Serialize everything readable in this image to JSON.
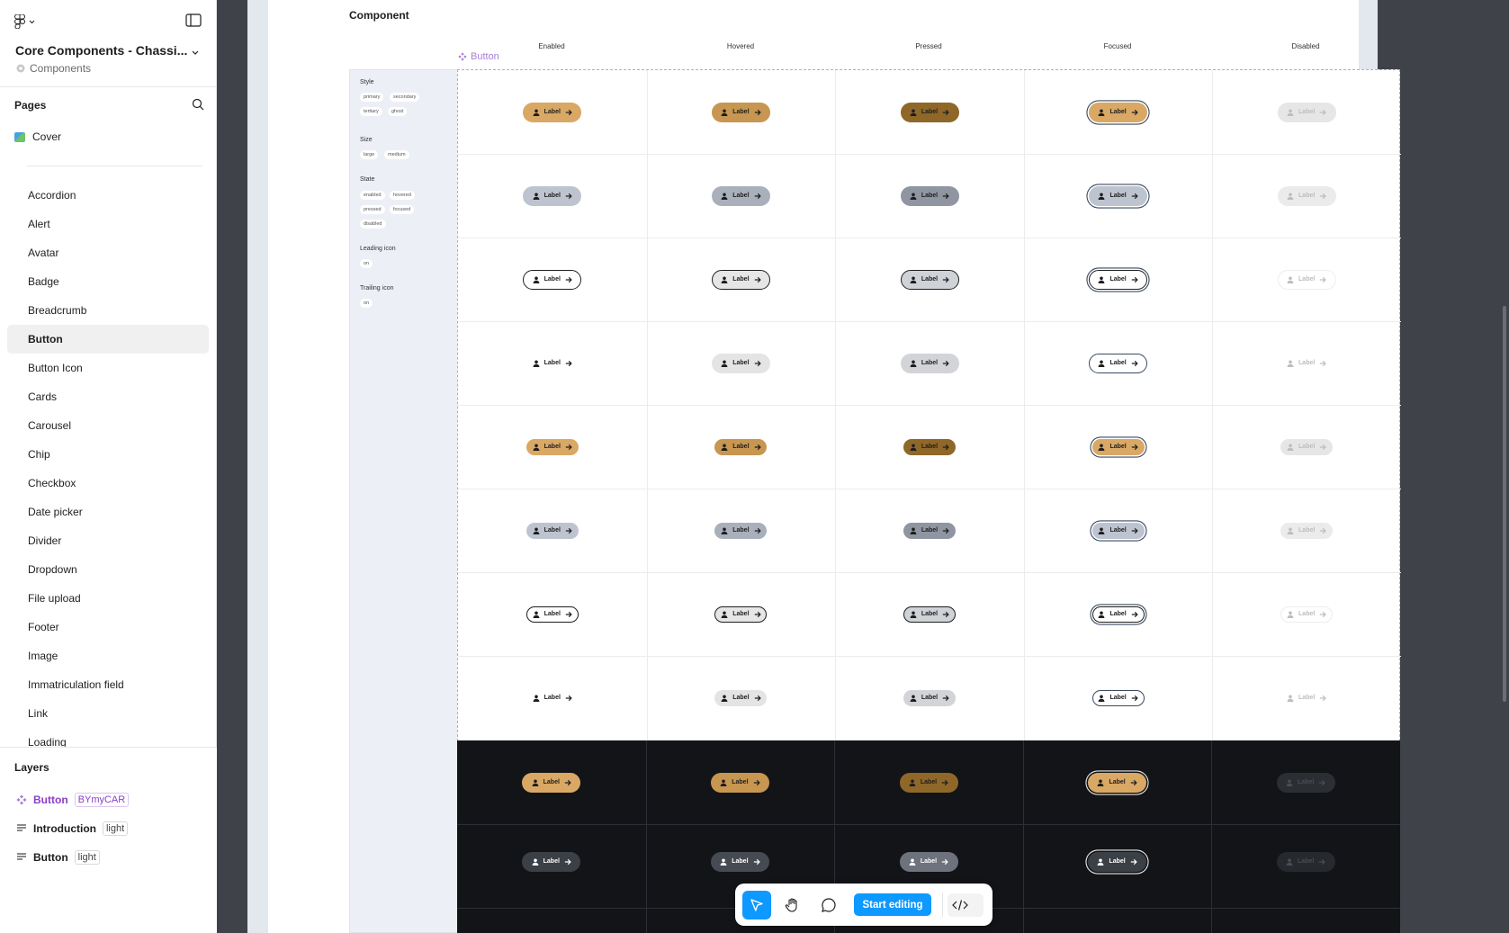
{
  "sidebar": {
    "file_title": "Core Components - Chassi...",
    "file_subtitle": "Components",
    "pages_heading": "Pages",
    "cover_page": "Cover",
    "pages": [
      "Accordion",
      "Alert",
      "Avatar",
      "Badge",
      "Breadcrumb",
      "Button",
      "Button Icon",
      "Cards",
      "Carousel",
      "Chip",
      "Checkbox",
      "Date picker",
      "Divider",
      "Dropdown",
      "File upload",
      "Footer",
      "Image",
      "Immatriculation field",
      "Link",
      "Loading"
    ],
    "active_page": "Button",
    "layers_heading": "Layers",
    "layers": [
      {
        "name": "Button",
        "badge": "BYmyCAR",
        "kind": "component"
      },
      {
        "name": "Introduction",
        "badge": "light",
        "kind": "frame"
      },
      {
        "name": "Button",
        "badge": "light",
        "kind": "frame"
      }
    ]
  },
  "canvas": {
    "section_title": "Component",
    "component_set_label": "Button",
    "column_headers": [
      "Enabled",
      "Hovered",
      "Pressed",
      "Focused",
      "Disabled"
    ],
    "button_label": "Label",
    "properties": [
      {
        "title": "Style",
        "values": [
          "primary",
          "secondary",
          "tertiary",
          "ghost"
        ]
      },
      {
        "title": "Size",
        "values": [
          "large",
          "medium"
        ]
      },
      {
        "title": "State",
        "values": [
          "enabled",
          "hovered",
          "pressed",
          "focused",
          "disabled"
        ]
      },
      {
        "title": "Leading icon",
        "values": [
          "on"
        ]
      },
      {
        "title": "Trailing icon",
        "values": [
          "on"
        ]
      }
    ],
    "colors": {
      "primary": [
        "#d9a865",
        "#c79650",
        "#8f6728",
        "#d9a865",
        "#e6e6e6"
      ],
      "secondary": [
        "#bec4cf",
        "#a9b0bc",
        "#8f96a2",
        "#bec4cf",
        "#ebebeb"
      ],
      "tertiary": [
        "#ffffff",
        "#e6e6e6",
        "#cfd2d7",
        "#ffffff",
        "#ffffff"
      ],
      "ghost": [
        "transparent",
        "#e4e4e4",
        "#d2d4d8",
        "#ffffff",
        "transparent"
      ],
      "focus_ring": "#3a4a63",
      "dark_bg": "#121417"
    }
  },
  "toolbar": {
    "start_editing": "Start editing"
  }
}
